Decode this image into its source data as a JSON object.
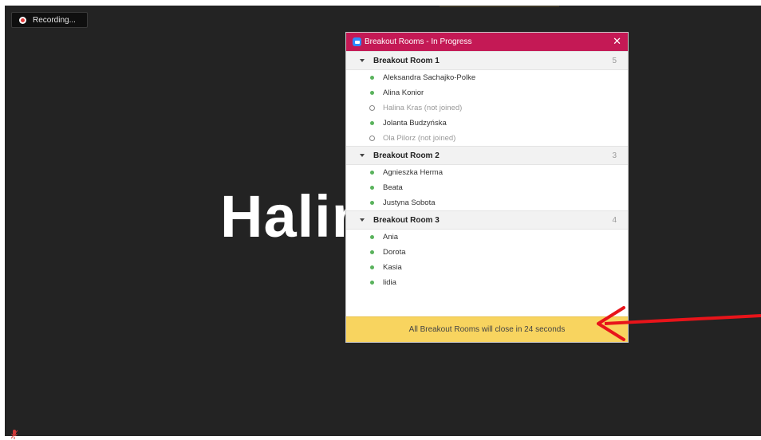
{
  "recording": {
    "label": "Recording..."
  },
  "speaker": {
    "name": "Halin"
  },
  "panel": {
    "title": "Breakout Rooms - In Progress",
    "close_label": "✕",
    "rooms": [
      {
        "name": "Breakout Room 1",
        "count": "5",
        "members": [
          {
            "name": "Aleksandra Sachajko-Polke",
            "joined": true
          },
          {
            "name": "Alina Konior",
            "joined": true
          },
          {
            "name": "Halina Kras (not joined)",
            "joined": false
          },
          {
            "name": "Jolanta Budzyńska",
            "joined": true
          },
          {
            "name": "Ola Pilorz (not joined)",
            "joined": false
          }
        ]
      },
      {
        "name": "Breakout Room 2",
        "count": "3",
        "members": [
          {
            "name": "Agnieszka Herma",
            "joined": true
          },
          {
            "name": "Beata",
            "joined": true
          },
          {
            "name": "Justyna Sobota",
            "joined": true
          }
        ]
      },
      {
        "name": "Breakout Room 3",
        "count": "4",
        "members": [
          {
            "name": "Ania",
            "joined": true
          },
          {
            "name": "Dorota",
            "joined": true
          },
          {
            "name": "Kasia",
            "joined": true
          },
          {
            "name": "lidia",
            "joined": true
          }
        ]
      }
    ],
    "footer": "All Breakout Rooms will close in 24 seconds"
  },
  "colors": {
    "titlebar": "#c41955",
    "footer": "#f8d45f",
    "joined_dot": "#59b25c",
    "arrow": "#e8141a"
  }
}
